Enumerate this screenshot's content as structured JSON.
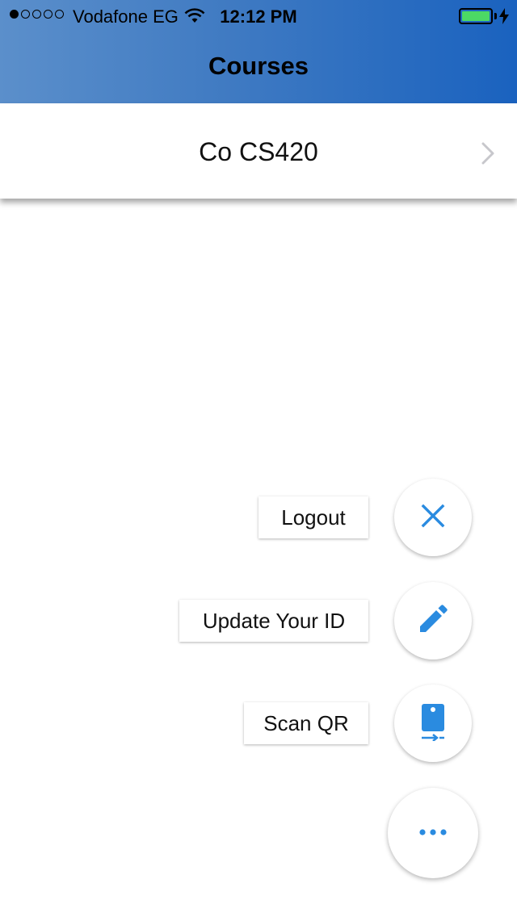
{
  "status_bar": {
    "carrier": "Vodafone EG",
    "time": "12:12 PM",
    "signal_bars_filled": 1,
    "signal_bars_total": 5,
    "battery_color": "#4cd964"
  },
  "header": {
    "title": "Courses",
    "gradient_start": "#5b8fcb",
    "gradient_end": "#1a62bf"
  },
  "courses": [
    {
      "label": "Co CS420"
    }
  ],
  "fab_menu": {
    "accent_color": "#2a8be0",
    "items": [
      {
        "label": "Logout",
        "icon": "close-icon"
      },
      {
        "label": "Update Your ID",
        "icon": "pencil-icon"
      },
      {
        "label": "Scan QR",
        "icon": "scan-device-icon"
      }
    ],
    "main_icon": "more-horizontal-icon"
  }
}
